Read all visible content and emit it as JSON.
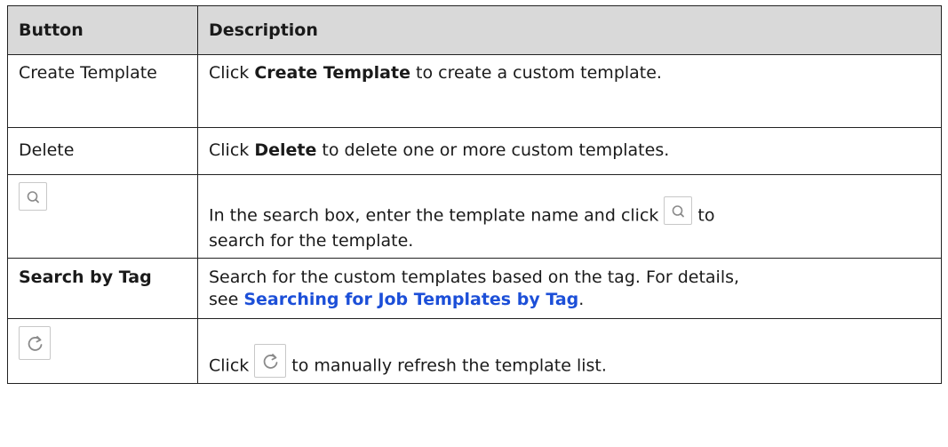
{
  "table": {
    "headers": {
      "button": "Button",
      "description": "Description"
    },
    "rows": [
      {
        "button": "Create Template",
        "desc_pre": "Click ",
        "desc_bold": "Create Template",
        "desc_post": " to create a custom template."
      },
      {
        "button": "Delete",
        "desc_pre": "Click ",
        "desc_bold": "Delete",
        "desc_post": " to delete one or more custom templates."
      },
      {
        "button_icon": "search-icon",
        "desc_pre": "In the search box, enter the template name and click",
        "desc_post": "to",
        "desc_line2": "search for the template."
      },
      {
        "button": "Search by Tag",
        "desc_pre": "Search for the custom templates based on the tag. For details,",
        "desc_see": "see ",
        "desc_link": "Searching for Job Templates by Tag",
        "desc_end": "."
      },
      {
        "button_icon": "refresh-icon",
        "desc_pre": "Click",
        "desc_post": "to manually refresh the template list."
      }
    ]
  },
  "colors": {
    "header_bg": "#d9d9d9",
    "border": "#222222",
    "link": "#1c4fd8",
    "icon_border": "#c8c8c8"
  }
}
